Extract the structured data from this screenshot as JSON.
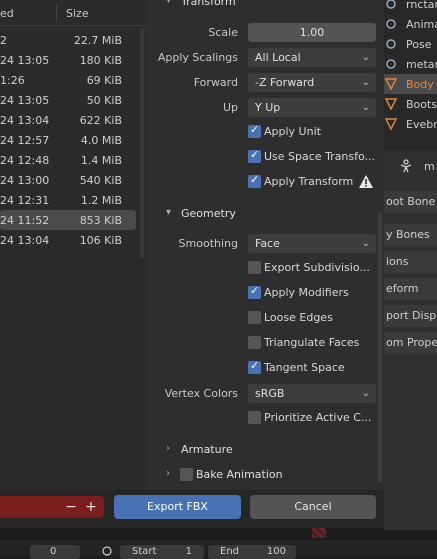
{
  "file_list": {
    "header": {
      "modified": "ed",
      "size": "Size"
    },
    "rows": [
      {
        "modified": "2",
        "size": "22.7 MiB"
      },
      {
        "modified": "24 13:05",
        "size": "180 KiB"
      },
      {
        "modified": "1:26",
        "size": "69 KiB"
      },
      {
        "modified": "24 13:05",
        "size": "50 KiB"
      },
      {
        "modified": "24 13:04",
        "size": "622 KiB"
      },
      {
        "modified": "24 12:57",
        "size": "4.0 MiB"
      },
      {
        "modified": "24 12:48",
        "size": "1.4 MiB"
      },
      {
        "modified": "24 13:00",
        "size": "540 KiB"
      },
      {
        "modified": "24 12:31",
        "size": "1.2 MiB"
      },
      {
        "modified": "24 11:52",
        "size": "853 KiB",
        "selected": true
      },
      {
        "modified": "24 13:04",
        "size": "106 KiB"
      }
    ]
  },
  "transform": {
    "section_title": "Transform",
    "scale": {
      "label": "Scale",
      "value": "1.00"
    },
    "apply_scalings": {
      "label": "Apply Scalings",
      "value": "All Local"
    },
    "forward": {
      "label": "Forward",
      "value": "-Z Forward"
    },
    "up": {
      "label": "Up",
      "value": "Y Up"
    },
    "apply_unit": {
      "label": "Apply Unit",
      "checked": true
    },
    "use_space_transform": {
      "label": "Use Space Transfo...",
      "checked": true
    },
    "apply_transform": {
      "label": "Apply Transform",
      "checked": true
    }
  },
  "geometry": {
    "section_title": "Geometry",
    "smoothing": {
      "label": "Smoothing",
      "value": "Face"
    },
    "export_subdivision": {
      "label": "Export Subdivisio...",
      "checked": false
    },
    "apply_modifiers": {
      "label": "Apply Modifiers",
      "checked": true
    },
    "loose_edges": {
      "label": "Loose Edges",
      "checked": false
    },
    "triangulate_faces": {
      "label": "Triangulate Faces",
      "checked": false
    },
    "tangent_space": {
      "label": "Tangent Space",
      "checked": true
    },
    "vertex_colors": {
      "label": "Vertex Colors",
      "value": "sRGB"
    },
    "prioritize_active": {
      "label": "Prioritize Active C...",
      "checked": false
    }
  },
  "armature": {
    "section_title": "Armature"
  },
  "bake_animation": {
    "section_title": "Bake Animation",
    "checked": false
  },
  "footer": {
    "minus": "−",
    "plus": "+",
    "export_label": "Export FBX",
    "cancel_label": "Cancel"
  },
  "outliner": {
    "rows": [
      {
        "text": "rnctang",
        "icon": "armature-icon"
      },
      {
        "text": "Anima",
        "icon": "animation-icon"
      },
      {
        "text": "Pose",
        "icon": "pose-icon"
      },
      {
        "text": "metar",
        "icon": "armature-icon"
      },
      {
        "text": "Body",
        "icon": "mesh-icon"
      },
      {
        "text": "Boots",
        "icon": "mesh-icon"
      },
      {
        "text": "Evebr",
        "icon": "mesh-icon"
      }
    ]
  },
  "properties": {
    "header_text": "m",
    "panels": [
      "oot Bone",
      "y Bones",
      "ions",
      "eform",
      "port Displ",
      "om Proper"
    ]
  },
  "bottom_strip": {
    "a": "0",
    "b": "Start",
    "c": "1",
    "d": "End",
    "e": "100"
  },
  "colors": {
    "accent": "#4772b3",
    "danger": "#7b1e1e",
    "warning": "#e8e8e8",
    "object_orange": "#e08a3c"
  }
}
